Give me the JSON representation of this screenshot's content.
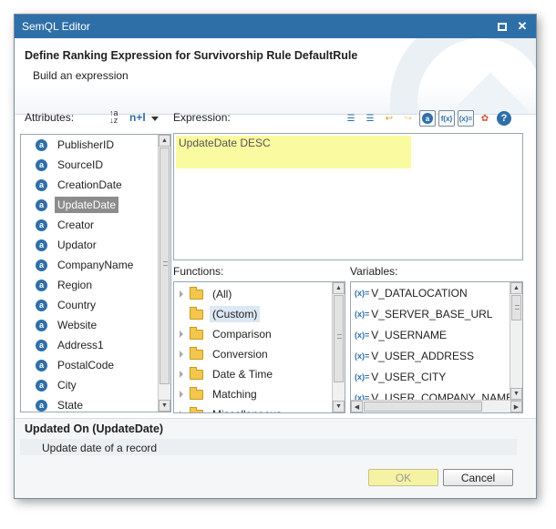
{
  "window": {
    "title": "SemQL Editor"
  },
  "header": {
    "title": "Define Ranking Expression for Survivorship Rule DefaultRule",
    "subtitle": "Build an expression"
  },
  "attributes": {
    "label": "Attributes:",
    "sort_label": "n+l",
    "items": [
      {
        "label": "PublisherID"
      },
      {
        "label": "SourceID"
      },
      {
        "label": "CreationDate"
      },
      {
        "label": "UpdateDate"
      },
      {
        "label": "Creator"
      },
      {
        "label": "Updator"
      },
      {
        "label": "CompanyName"
      },
      {
        "label": "Region"
      },
      {
        "label": "Country"
      },
      {
        "label": "Website"
      },
      {
        "label": "Address1"
      },
      {
        "label": "PostalCode"
      },
      {
        "label": "City"
      },
      {
        "label": "State"
      }
    ],
    "selected": "UpdateDate"
  },
  "expression": {
    "label": "Expression:",
    "value": "UpdateDate DESC"
  },
  "functions": {
    "label": "Functions:",
    "items": [
      {
        "label": "(All)"
      },
      {
        "label": "(Custom)"
      },
      {
        "label": "Comparison"
      },
      {
        "label": "Conversion"
      },
      {
        "label": "Date & Time"
      },
      {
        "label": "Matching"
      },
      {
        "label": "Miscellaneous"
      }
    ],
    "selected": "(Custom)"
  },
  "variables": {
    "label": "Variables:",
    "items": [
      {
        "label": "V_DATALOCATION"
      },
      {
        "label": "V_SERVER_BASE_URL"
      },
      {
        "label": "V_USERNAME"
      },
      {
        "label": "V_USER_ADDRESS"
      },
      {
        "label": "V_USER_CITY"
      },
      {
        "label": "V_USER_COMPANY_NAME"
      }
    ]
  },
  "description": {
    "title": "Updated On (UpdateDate)",
    "text": "Update date of a record"
  },
  "buttons": {
    "ok": "OK",
    "cancel": "Cancel"
  },
  "colors": {
    "titlebar": "#2f6fa8",
    "selection": "#8c8c8c",
    "expression_highlight": "#fafaa0"
  }
}
